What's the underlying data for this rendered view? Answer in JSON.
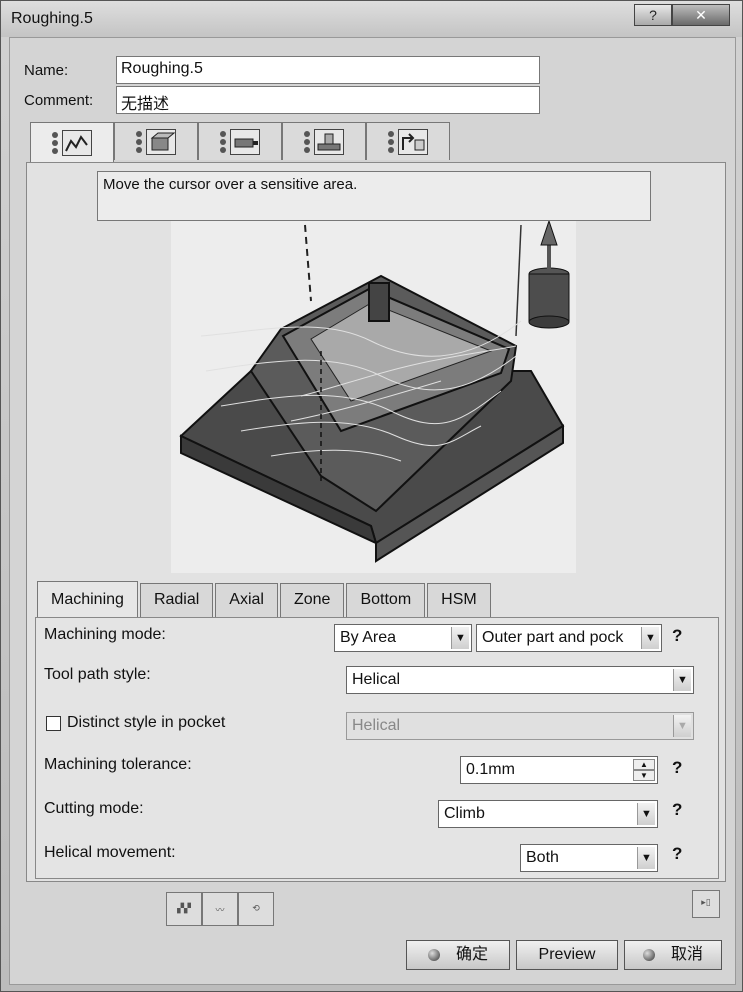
{
  "window": {
    "title": "Roughing.5",
    "help_btn": "?",
    "close_btn": "✕"
  },
  "form": {
    "name_label": "Name:",
    "name_value": "Roughing.5",
    "comment_label": "Comment:",
    "comment_value": "无描述"
  },
  "icon_tabs": [
    "strategy-tab",
    "geometry-tab",
    "tool-tab",
    "feeds-speeds-tab",
    "macros-tab"
  ],
  "hint_text": "Move the cursor over a sensitive area.",
  "sub_tabs": [
    "Machining",
    "Radial",
    "Axial",
    "Zone",
    "Bottom",
    "HSM"
  ],
  "machining": {
    "mode_label": "Machining mode:",
    "mode_value1": "By Area",
    "mode_value2": "Outer part and pock",
    "tool_path_label": "Tool path style:",
    "tool_path_value": "Helical",
    "distinct_label": "Distinct style in pocket",
    "distinct_value": "Helical",
    "tolerance_label": "Machining tolerance:",
    "tolerance_value": "0.1mm",
    "cutting_label": "Cutting mode:",
    "cutting_value": "Climb",
    "helical_label": "Helical movement:",
    "helical_value": "Both",
    "help": "?"
  },
  "bottom_buttons": {
    "ok": "确定",
    "preview": "Preview",
    "cancel": "取消"
  }
}
